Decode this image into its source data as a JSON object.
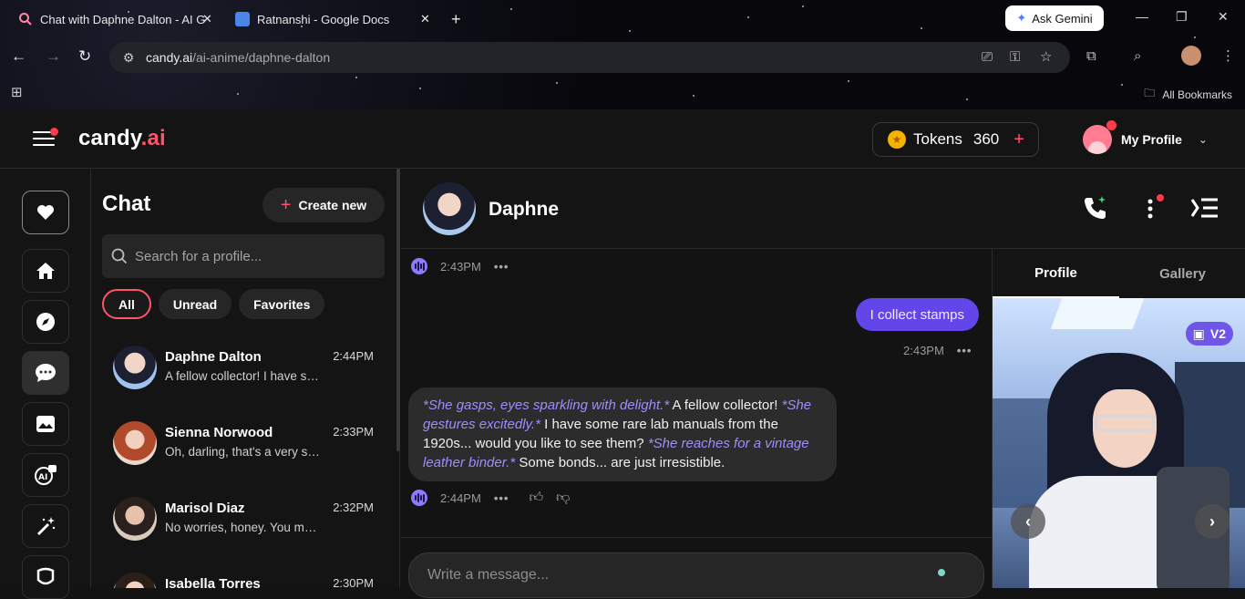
{
  "browser": {
    "tabs": [
      {
        "title": "Chat with Daphne Dalton - AI G",
        "active": true
      },
      {
        "title": "Ratnanshi - Google Docs",
        "active": false
      }
    ],
    "ask_gemini": "Ask Gemini",
    "url_host": "candy.ai",
    "url_path": "/ai-anime/daphne-dalton",
    "all_bookmarks": "All Bookmarks"
  },
  "app": {
    "logo_main": "candy",
    "logo_dot_ai": ".ai",
    "tokens_label": "Tokens",
    "tokens_count": "360",
    "profile_label": "My Profile",
    "accent": "#ff5369"
  },
  "chatlist": {
    "title": "Chat",
    "create_new": "Create new",
    "search_placeholder": "Search for a profile...",
    "filters": [
      "All",
      "Unread",
      "Favorites"
    ],
    "items": [
      {
        "name": "Daphne Dalton",
        "time": "2:44PM",
        "preview": "A fellow collector! I have some rare lab manuals"
      },
      {
        "name": "Sienna Norwood",
        "time": "2:33PM",
        "preview": "Oh, darling, that's a very sweet thought"
      },
      {
        "name": "Marisol Diaz",
        "time": "2:32PM",
        "preview": "No worries, honey. You may be"
      },
      {
        "name": "Isabella Torres",
        "time": "2:30PM",
        "preview": ""
      }
    ]
  },
  "conversation": {
    "name": "Daphne",
    "messages": [
      {
        "role": "ai",
        "time": "2:43PM"
      },
      {
        "role": "user",
        "text": "I collect stamps",
        "time": "2:43PM"
      },
      {
        "role": "ai",
        "time": "2:44PM",
        "segments": [
          {
            "t": "*She gasps, eyes sparkling with delight.*",
            "em": true
          },
          {
            "t": " A fellow collector! ",
            "em": false
          },
          {
            "t": "*She gestures excitedly.*",
            "em": true
          },
          {
            "t": " I have some rare lab manuals from the 1920s... would you like to see them? ",
            "em": false
          },
          {
            "t": "*She reaches for a vintage leather binder.*",
            "em": true
          },
          {
            "t": " Some bonds... are just irresistible.",
            "em": false
          }
        ]
      }
    ],
    "composer_placeholder": "Write a message...",
    "user_bubble_color": "#6246ea"
  },
  "panel": {
    "tabs": [
      "Profile",
      "Gallery"
    ],
    "badge": "V2"
  }
}
